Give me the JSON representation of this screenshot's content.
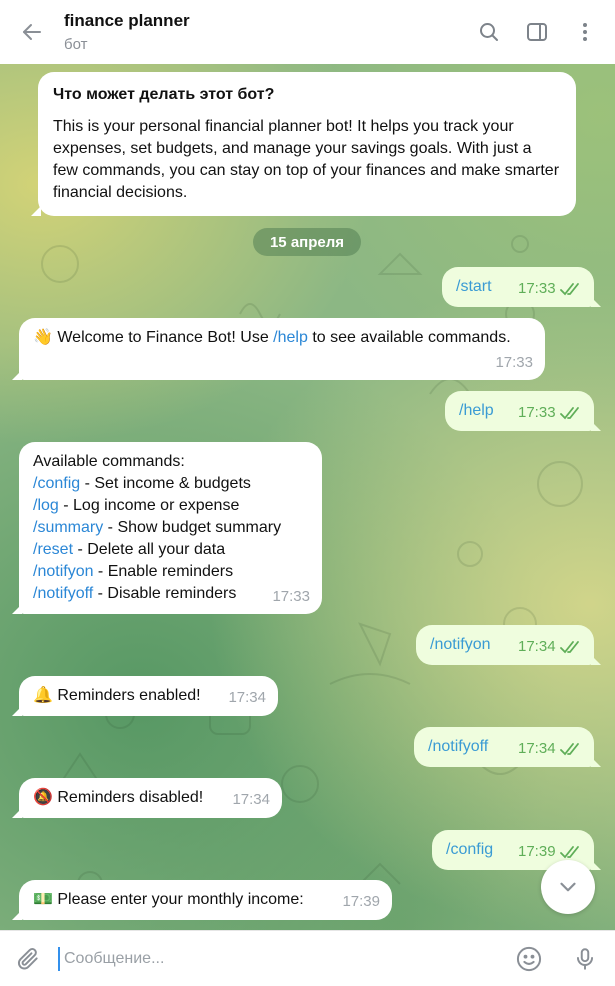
{
  "header": {
    "title": "finance planner",
    "subtitle": "бот"
  },
  "intro": {
    "heading": "Что может делать этот бот?",
    "text": "This is your personal financial planner bot! It helps you track your expenses, set budgets, and manage your savings goals. With just a few commands, you can stay on top of your finances and make smarter financial decisions."
  },
  "date_separator": "15 апреля",
  "messages": [
    {
      "id": "m1",
      "dir": "out",
      "text": "/start",
      "time": "17:33"
    },
    {
      "id": "m2",
      "dir": "in",
      "emoji": "👋",
      "pre": " Welcome to Finance Bot! Use ",
      "link": "/help",
      "post": " to see available commands.",
      "time": "17:33"
    },
    {
      "id": "m3",
      "dir": "out",
      "text": "/help",
      "time": "17:33"
    },
    {
      "id": "m4",
      "dir": "in",
      "heading": "Available commands:",
      "commands": [
        {
          "cmd": "/config",
          "desc": " - Set income & budgets"
        },
        {
          "cmd": "/log",
          "desc": " - Log income or expense"
        },
        {
          "cmd": "/summary",
          "desc": " - Show budget summary"
        },
        {
          "cmd": "/reset",
          "desc": " - Delete all your data"
        },
        {
          "cmd": "/notifyon",
          "desc": " - Enable reminders"
        },
        {
          "cmd": "/notifyoff",
          "desc": " - Disable reminders"
        }
      ],
      "time": "17:33"
    },
    {
      "id": "m5",
      "dir": "out",
      "text": "/notifyon",
      "time": "17:34"
    },
    {
      "id": "m6",
      "dir": "in",
      "emoji": "🔔",
      "text": " Reminders enabled!",
      "time": "17:34"
    },
    {
      "id": "m7",
      "dir": "out",
      "text": "/notifyoff",
      "time": "17:34"
    },
    {
      "id": "m8",
      "dir": "in",
      "emoji": "🔕",
      "text": " Reminders disabled!",
      "time": "17:34"
    },
    {
      "id": "m9",
      "dir": "out",
      "text": "/config",
      "time": "17:39"
    },
    {
      "id": "m10",
      "dir": "in",
      "emoji": "💵",
      "text": " Please enter your monthly income:",
      "time": "17:39"
    }
  ],
  "composer": {
    "placeholder": "Сообщение..."
  },
  "icons": {
    "back": "arrow-left-icon",
    "search": "search-icon",
    "sidebar": "sidebar-toggle-icon",
    "more": "more-vertical-icon",
    "read": "double-check-icon",
    "scroll": "chevron-down-icon",
    "attach": "paperclip-icon",
    "emoji": "smiley-icon",
    "mic": "microphone-icon"
  },
  "colors": {
    "accent": "#3390ec",
    "out_bubble": "#effdde",
    "in_bubble": "#ffffff",
    "link": "#2b87d6",
    "read_check": "#5fae58"
  }
}
